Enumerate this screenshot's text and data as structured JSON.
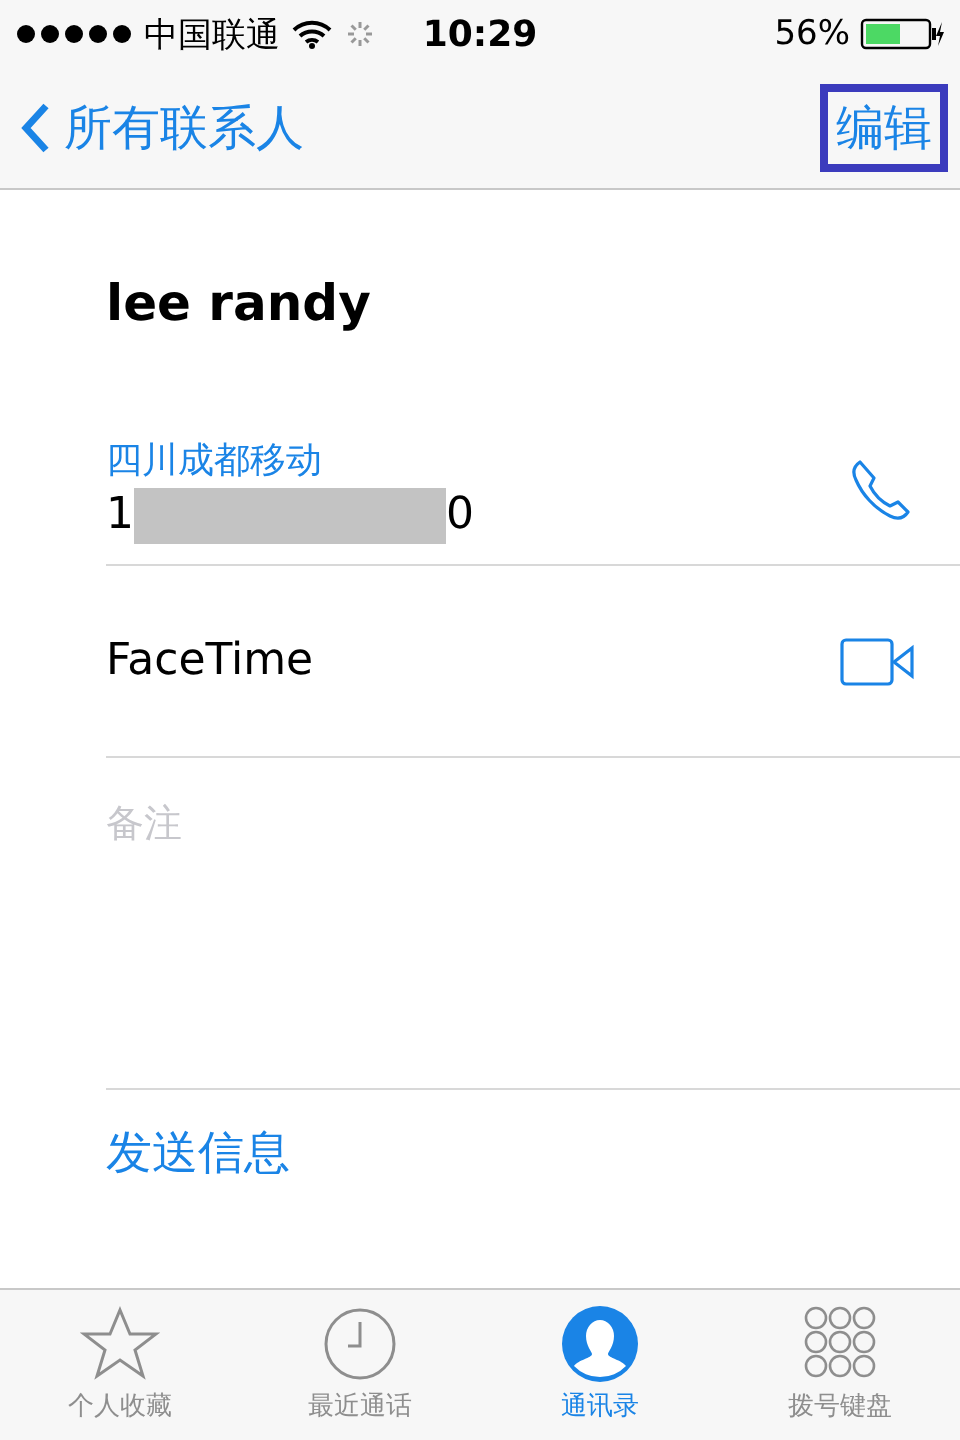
{
  "status_bar": {
    "carrier": "中国联通",
    "time": "10:29",
    "battery": "56%"
  },
  "nav": {
    "back": "所有联系人",
    "action": "编辑",
    "action_highlighted": true
  },
  "contact": {
    "name": "lee randy"
  },
  "phone": {
    "label": "四川成都移动",
    "number_start": "1",
    "number_end": "0",
    "redacted": true
  },
  "facetime": {
    "label": "FaceTime"
  },
  "notes": {
    "placeholder": "备注"
  },
  "send_message": "发送信息",
  "tabs": [
    {
      "kind": "favorites",
      "label": "个人收藏",
      "selected": false
    },
    {
      "kind": "recents",
      "label": "最近通话",
      "selected": false
    },
    {
      "kind": "contacts",
      "label": "通讯录",
      "selected": true
    },
    {
      "kind": "keypad",
      "label": "拨号键盘",
      "selected": false
    }
  ]
}
